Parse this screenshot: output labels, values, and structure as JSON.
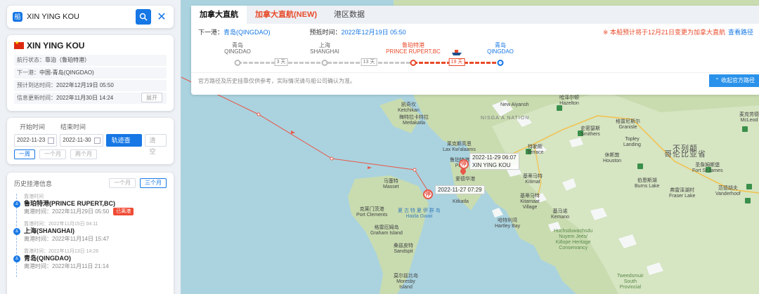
{
  "search": {
    "badge": "船",
    "query": "XIN YING KOU"
  },
  "ship": {
    "name": "XIN YING KOU",
    "rows": [
      {
        "label": "航行状态：",
        "value": "靠泊（鲁珀特港）"
      },
      {
        "label": "下一港：",
        "value": "中国-青岛(QINGDAO)"
      },
      {
        "label": "预计到达时间：",
        "value": "2022年12月19日 05:50"
      },
      {
        "label": "信息更新时间：",
        "value": "2022年11月30日 14:24"
      }
    ],
    "expand_label": "展开"
  },
  "query": {
    "start_label": "开始时间",
    "end_label": "结束时间",
    "start_value": "2022-11-23",
    "end_value": "2022-11-30",
    "query_button": "轨迹查询",
    "clear_button": "清空",
    "ranges": [
      "一周",
      "一个月",
      "两个月"
    ]
  },
  "history": {
    "title": "历史挂港信息",
    "ranges": [
      "一个月",
      "三个月"
    ],
    "items": [
      {
        "top": "靠港时间",
        "name": "鲁珀特港(PRINCE RUPERT,BC)",
        "line": "离港时间：2022年11月29日 05:50",
        "tag": "已离港"
      },
      {
        "top": "靠港时间：2022年11月15日 04:11",
        "name": "上海(SHANGHAI)",
        "line": "离港时间：2022年11月14日 15:47",
        "tag": ""
      },
      {
        "top": "靠港时间：2022年11月13日 14:26",
        "name": "青岛(QINGDAO)",
        "line": "离港时间：2022年11月11日 21:14",
        "tag": ""
      }
    ]
  },
  "tabs": [
    "加拿大直航",
    "加拿大直航(NEW)",
    "港区数据"
  ],
  "nextport": {
    "label": "下一港：",
    "value": "青岛(QINGDAO)",
    "eta_label": "预抵时间：",
    "eta_value": "2022年12月19日 05:50",
    "warning": "※ 本船预计将于12月21日变更为加拿大直航",
    "route_link": "查看路径"
  },
  "route": {
    "ports": [
      {
        "cn": "青岛",
        "en": "QINGDAO"
      },
      {
        "cn": "上海",
        "en": "SHANGHAI"
      },
      {
        "cn": "鲁珀特港",
        "en": "PRINCE RUPERT,BC"
      },
      {
        "cn": "青岛",
        "en": "QINGDAO"
      }
    ],
    "legs": [
      "3 天",
      "13 天",
      "19 天"
    ]
  },
  "footnote": "官方路径及历史挂靠仅供参考，实际情况请与船公司确认为准。",
  "collapse_button": "收起官方路径",
  "map": {
    "tip1": "2022-11-29 06:07",
    "tip1b": "XIN YING KOU",
    "tip2": "2022-11-27 07:29",
    "stop_icon": "停",
    "labels": {
      "ketchikan": "凯奇坎\nKetchikan",
      "metlakatla": "梅特拉卡特拉\nMetlakatla",
      "lax": "莱克斯高恩\nLax Kw'alaams",
      "prince_rupert": "鲁珀特港\nPrince",
      "port_ed": "爱德华港",
      "masset": "马塞特\nMasset",
      "port_clements": "克莱门茨港\nPort Clements",
      "haida": "夏 古 特 夏 伊 群 岛\nHaida Gwaii",
      "graham": "格雷厄姆岛\nGraham Island",
      "sandspit": "桑兹皮特\nSandspit",
      "moresby": "莫尔兹比岛\nMoresby\nIsland",
      "kitkatla": "Kitkatla",
      "hartley": "哈特利湾\nHartley Bay",
      "kitimaat": "基蒂马特\nKitamaat\nVillage",
      "kitimat": "基蒂马特\nKitimat",
      "kemano": "基马诺\nKemano",
      "terrace": "特勒斯\nTerrace",
      "new_aiyansh": "New Aiyansh",
      "nisgaa": "NISGA'A NATION",
      "smithers": "史密瑟斯\nSmithers",
      "houston": "休斯敦\nHouston",
      "topley": "Topley\nLanding",
      "granisle": "格雷尼斯尔\nGranisle",
      "bc": "不列颠\n哥伦比亚省",
      "fort_st_james": "圣詹姆斯堡\nFort St James",
      "burns_lake": "伯恩斯湖\nBurns Lake",
      "fraser_lake": "弗雷泽湖村\nFraser Lake",
      "vanderhoof": "范德胡夫\nVanderhoof",
      "hazelton": "哈泽尔顿\nHazelton",
      "mcleod": "麦克劳德\nMcLeod",
      "huchs": "Huchsduwachsdu\nNuyem Jees/\nKitlope Heritage\nConservancy",
      "tweedsmuir": "Tweedsmuir\nSouth\nProvincial"
    }
  }
}
